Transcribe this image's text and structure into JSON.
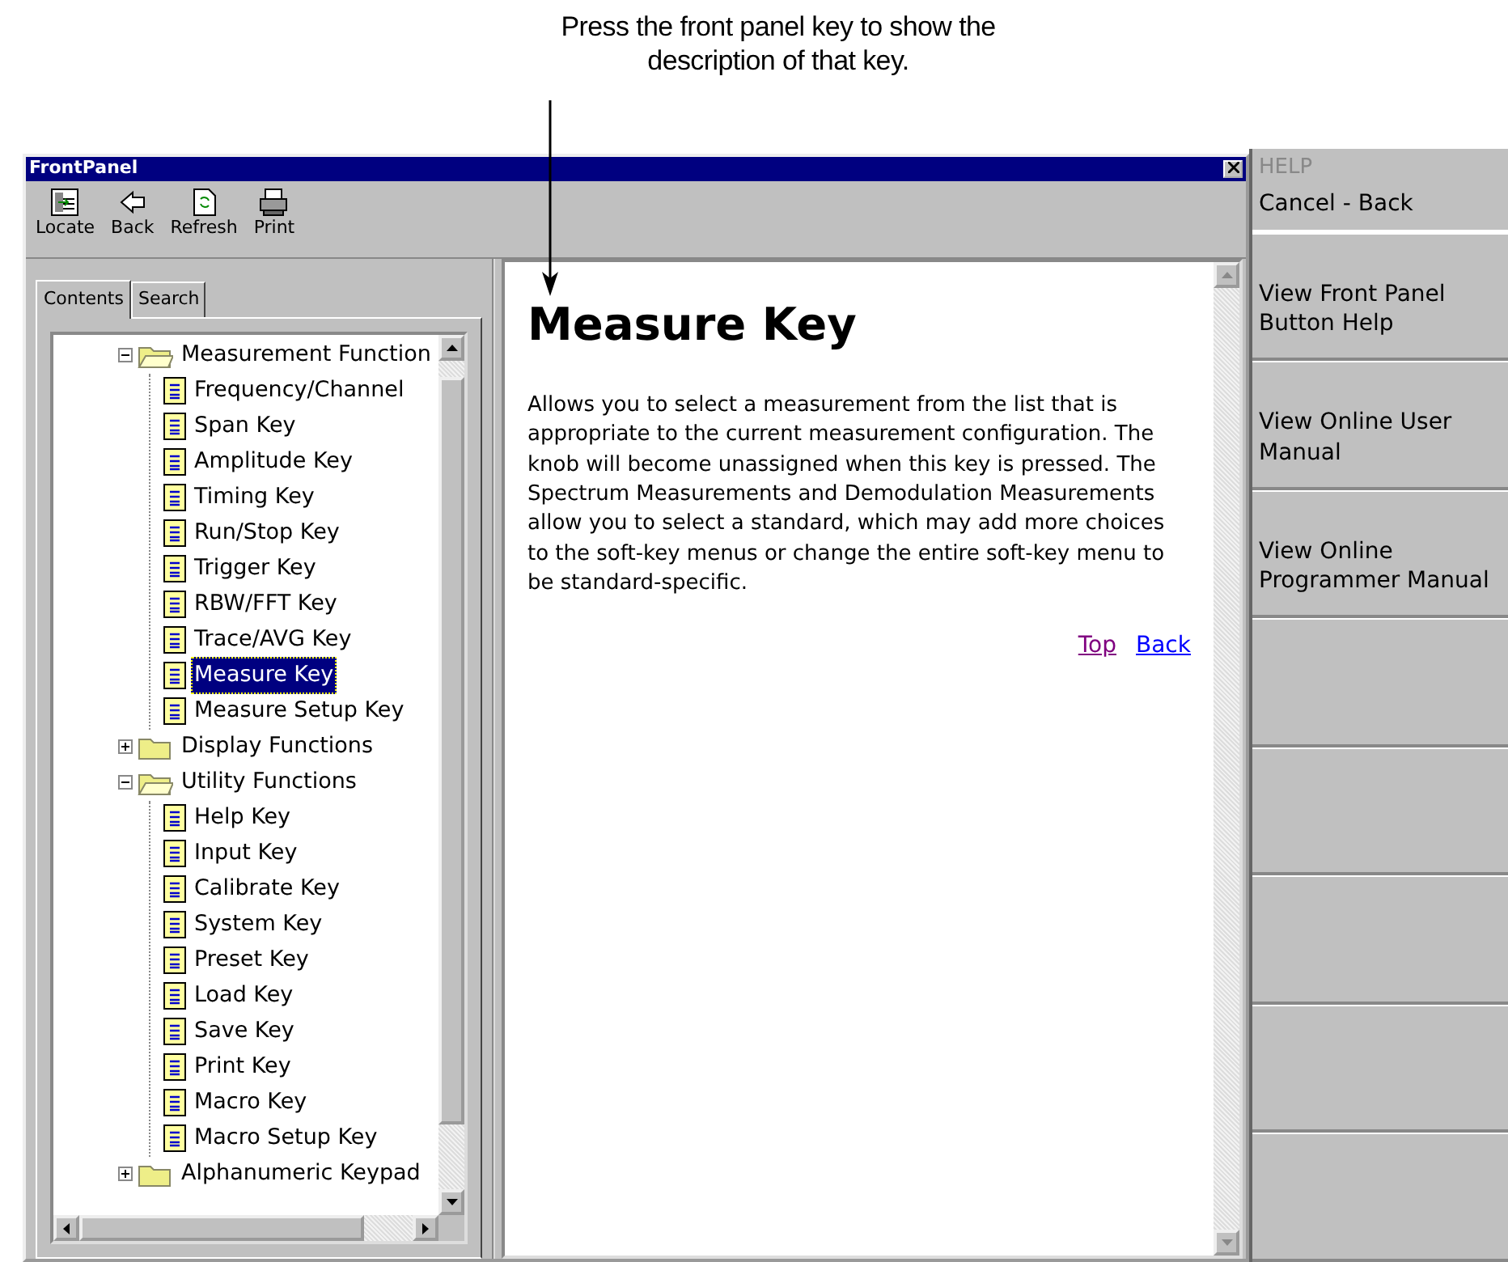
{
  "caption": "Press the front panel key to show the description of that key.",
  "window": {
    "title": "FrontPanel"
  },
  "toolbar": [
    {
      "label": "Locate",
      "kind": "locate"
    },
    {
      "label": "Back",
      "kind": "back"
    },
    {
      "label": "Refresh",
      "kind": "refresh"
    },
    {
      "label": "Print",
      "kind": "print"
    }
  ],
  "tabs": [
    {
      "label": "Contents",
      "selected": true
    },
    {
      "label": "Search",
      "selected": false
    }
  ],
  "tree": [
    {
      "label": "Measurement Function",
      "kind": "folder",
      "expanded": true,
      "children": [
        {
          "label": "Frequency/Channel",
          "kind": "page",
          "selected": false
        },
        {
          "label": "Span Key",
          "kind": "page",
          "selected": false
        },
        {
          "label": "Amplitude Key",
          "kind": "page",
          "selected": false
        },
        {
          "label": "Timing Key",
          "kind": "page",
          "selected": false
        },
        {
          "label": "Run/Stop Key",
          "kind": "page",
          "selected": false
        },
        {
          "label": "Trigger Key",
          "kind": "page",
          "selected": false
        },
        {
          "label": "RBW/FFT Key",
          "kind": "page",
          "selected": false
        },
        {
          "label": "Trace/AVG Key",
          "kind": "page",
          "selected": false
        },
        {
          "label": "Measure Key",
          "kind": "page",
          "selected": true
        },
        {
          "label": "Measure Setup Key",
          "kind": "page",
          "selected": false
        }
      ]
    },
    {
      "label": "Display Functions",
      "kind": "folder",
      "expanded": false
    },
    {
      "label": "Utility Functions",
      "kind": "folder",
      "expanded": true,
      "children": [
        {
          "label": "Help Key",
          "kind": "page",
          "selected": false
        },
        {
          "label": "Input Key",
          "kind": "page",
          "selected": false
        },
        {
          "label": "Calibrate Key",
          "kind": "page",
          "selected": false
        },
        {
          "label": "System Key",
          "kind": "page",
          "selected": false
        },
        {
          "label": "Preset Key",
          "kind": "page",
          "selected": false
        },
        {
          "label": "Load Key",
          "kind": "page",
          "selected": false
        },
        {
          "label": "Save Key",
          "kind": "page",
          "selected": false
        },
        {
          "label": "Print Key",
          "kind": "page",
          "selected": false
        },
        {
          "label": "Macro Key",
          "kind": "page",
          "selected": false
        },
        {
          "label": "Macro Setup Key",
          "kind": "page",
          "selected": false
        }
      ]
    },
    {
      "label": "Alphanumeric Keypad",
      "kind": "folder",
      "expanded": false
    }
  ],
  "topic": {
    "heading": "Measure Key",
    "body": "Allows you to select a measurement from the list that is appropriate to the current measurement configuration. The knob will become unassigned when this key is pressed. The Spectrum Measurements and Demodulation Measurements allow you to select a standard, which may add more choices to the soft-key menus or change the entire soft-key menu to be standard-specific.",
    "links": [
      {
        "label": "Top",
        "visited": true
      },
      {
        "label": "Back",
        "visited": false
      }
    ]
  },
  "softkeys": {
    "menu_title": "HELP",
    "title": "Cancel - Back",
    "buttons": [
      {
        "kind": "labeled",
        "label": "View Front Panel Button Help"
      },
      {
        "kind": "labeled",
        "label": "View Online User Manual"
      },
      {
        "kind": "labeled",
        "label": "View Online Programmer Manual"
      },
      {
        "kind": "blank"
      },
      {
        "kind": "blank"
      },
      {
        "kind": "blank"
      },
      {
        "kind": "blank"
      },
      {
        "kind": "blank"
      }
    ]
  }
}
